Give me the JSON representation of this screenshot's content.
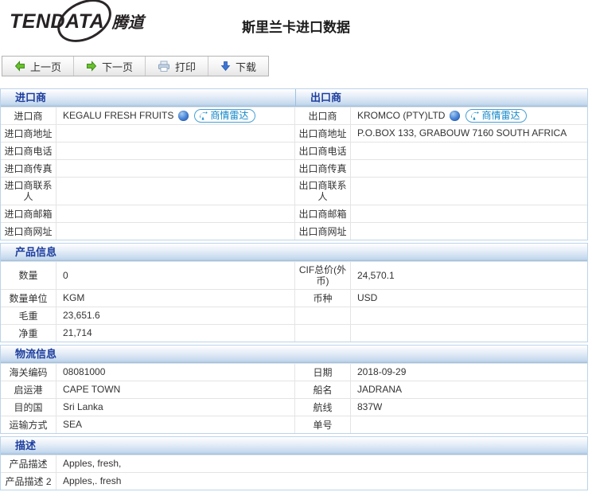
{
  "logo": {
    "brand": "TENDATA",
    "brand_cn": "腾道"
  },
  "page_title": "斯里兰卡进口数据",
  "toolbar": {
    "prev_label": "上一页",
    "next_label": "下一页",
    "print_label": "打印",
    "download_label": "下载"
  },
  "radar_button_label": "商情雷达",
  "colors": {
    "section_header_text": "#1e3e9e",
    "section_border": "#bcd4ea",
    "radar_blue": "#0f86c8",
    "arrow_green": "#6abf2e",
    "arrow_blue": "#3b74d4"
  },
  "sections": [
    {
      "style": "double",
      "left_header": "进口商",
      "right_header": "出口商",
      "rows": [
        {
          "cells": [
            {
              "label": "进口商",
              "value": "KEGALU FRESH FRUITS",
              "icons": true
            },
            {
              "label": "出口商",
              "value": "KROMCO (PTY)LTD",
              "icons": true
            }
          ]
        },
        {
          "cells": [
            {
              "label": "进口商地址",
              "value": ""
            },
            {
              "label": "出口商地址",
              "value": "P.O.BOX 133, GRABOUW 7160 SOUTH AFRICA"
            }
          ]
        },
        {
          "cells": [
            {
              "label": "进口商电话",
              "value": ""
            },
            {
              "label": "出口商电话",
              "value": ""
            }
          ]
        },
        {
          "cells": [
            {
              "label": "进口商传真",
              "value": ""
            },
            {
              "label": "出口商传真",
              "value": ""
            }
          ]
        },
        {
          "cells": [
            {
              "label": "进口商联系人",
              "value": ""
            },
            {
              "label": "出口商联系人",
              "value": ""
            }
          ]
        },
        {
          "cells": [
            {
              "label": "进口商邮箱",
              "value": ""
            },
            {
              "label": "出口商邮箱",
              "value": ""
            }
          ]
        },
        {
          "cells": [
            {
              "label": "进口商网址",
              "value": ""
            },
            {
              "label": "出口商网址",
              "value": ""
            }
          ]
        }
      ]
    },
    {
      "style": "single",
      "header": "产品信息",
      "rows": [
        {
          "cells": [
            {
              "label": "数量",
              "value": "0"
            },
            {
              "label": "CIF总价(外币)",
              "value": "24,570.1"
            }
          ]
        },
        {
          "cells": [
            {
              "label": "数量单位",
              "value": "KGM"
            },
            {
              "label": "币种",
              "value": "USD"
            }
          ]
        },
        {
          "cells": [
            {
              "label": "毛重",
              "value": "23,651.6"
            },
            {
              "label": "",
              "value": ""
            }
          ]
        },
        {
          "cells": [
            {
              "label": "净重",
              "value": "21,714"
            },
            {
              "label": "",
              "value": ""
            }
          ]
        }
      ]
    },
    {
      "style": "single",
      "header": "物流信息",
      "rows": [
        {
          "cells": [
            {
              "label": "海关编码",
              "value": "08081000"
            },
            {
              "label": "日期",
              "value": "2018-09-29"
            }
          ]
        },
        {
          "cells": [
            {
              "label": "启运港",
              "value": "CAPE TOWN"
            },
            {
              "label": "船名",
              "value": "JADRANA"
            }
          ]
        },
        {
          "cells": [
            {
              "label": "目的国",
              "value": "Sri Lanka"
            },
            {
              "label": "航线",
              "value": "837W"
            }
          ]
        },
        {
          "cells": [
            {
              "label": "运输方式",
              "value": "SEA"
            },
            {
              "label": "单号",
              "value": ""
            }
          ]
        }
      ]
    },
    {
      "style": "fullwidth",
      "header": "描述",
      "rows": [
        {
          "cells": [
            {
              "label": "产品描述",
              "value": "Apples, fresh,"
            }
          ]
        },
        {
          "cells": [
            {
              "label": "产品描述 2",
              "value": "Apples,. fresh"
            }
          ]
        }
      ]
    }
  ]
}
